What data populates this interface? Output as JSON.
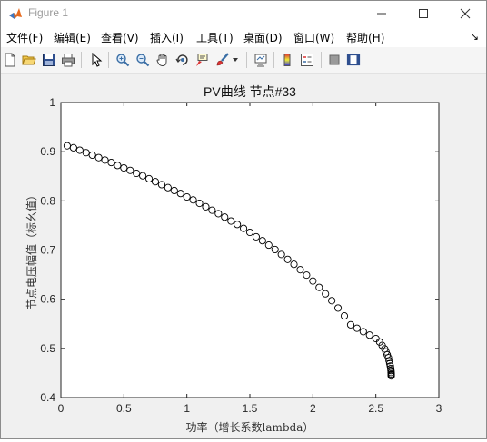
{
  "window": {
    "title": "Figure 1",
    "controls": [
      "minimize",
      "maximize",
      "close"
    ]
  },
  "menu": {
    "items": [
      "文件(F)",
      "编辑(E)",
      "查看(V)",
      "插入(I)",
      "工具(T)",
      "桌面(D)",
      "窗口(W)",
      "帮助(H)"
    ],
    "overflow_arrow": "↘"
  },
  "toolbar": {
    "icons": [
      "new-figure-icon",
      "open-file-icon",
      "save-icon",
      "print-icon",
      "edit-plot-arrow-icon",
      "zoom-in-icon",
      "zoom-out-icon",
      "pan-hand-icon",
      "rotate-3d-icon",
      "data-cursor-icon",
      "brush-icon",
      "brush-dropdown-icon",
      "link-plot-icon",
      "insert-colorbar-icon",
      "insert-legend-icon",
      "hide-plot-tools-icon",
      "show-plot-tools-icon"
    ]
  },
  "chart_data": {
    "type": "scatter",
    "title": "PV曲线 节点#33",
    "xlabel": "功率（增长系数lambda）",
    "ylabel": "节点电压幅值（标幺值）",
    "xlim": [
      0,
      3
    ],
    "ylim": [
      0.4,
      1
    ],
    "xticks": [
      "0",
      "0.5",
      "1",
      "1.5",
      "2",
      "2.5",
      "3"
    ],
    "yticks": [
      "0.4",
      "0.5",
      "0.6",
      "0.7",
      "0.8",
      "0.9",
      "1"
    ],
    "grid": false,
    "marker": "circle",
    "marker_color": "#000000",
    "series": [
      {
        "x": [
          0.05,
          0.1,
          0.15,
          0.2,
          0.25,
          0.3,
          0.35,
          0.4,
          0.45,
          0.5,
          0.55,
          0.6,
          0.65,
          0.7,
          0.75,
          0.8,
          0.85,
          0.9,
          0.95,
          1.0,
          1.05,
          1.1,
          1.15,
          1.2,
          1.25,
          1.3,
          1.35,
          1.4,
          1.45,
          1.5,
          1.55,
          1.6,
          1.65,
          1.7,
          1.75,
          1.8,
          1.85,
          1.9,
          1.95,
          2.0,
          2.05,
          2.1,
          2.15,
          2.2,
          2.25,
          2.3,
          2.35,
          2.4,
          2.45,
          2.5,
          2.53,
          2.55,
          2.57,
          2.58,
          2.59,
          2.6,
          2.605,
          2.61,
          2.615,
          2.618,
          2.62,
          2.621,
          2.622,
          2.622,
          2.622
        ],
        "y": [
          0.912,
          0.908,
          0.903,
          0.898,
          0.893,
          0.888,
          0.883,
          0.878,
          0.872,
          0.867,
          0.862,
          0.856,
          0.851,
          0.845,
          0.839,
          0.833,
          0.827,
          0.821,
          0.815,
          0.808,
          0.802,
          0.795,
          0.788,
          0.781,
          0.774,
          0.767,
          0.759,
          0.752,
          0.744,
          0.736,
          0.727,
          0.719,
          0.71,
          0.701,
          0.691,
          0.681,
          0.671,
          0.66,
          0.649,
          0.637,
          0.624,
          0.611,
          0.597,
          0.582,
          0.566,
          0.548,
          0.541,
          0.534,
          0.527,
          0.52,
          0.513,
          0.506,
          0.499,
          0.493,
          0.487,
          0.481,
          0.475,
          0.469,
          0.464,
          0.459,
          0.455,
          0.451,
          0.448,
          0.446,
          0.444
        ]
      }
    ]
  }
}
